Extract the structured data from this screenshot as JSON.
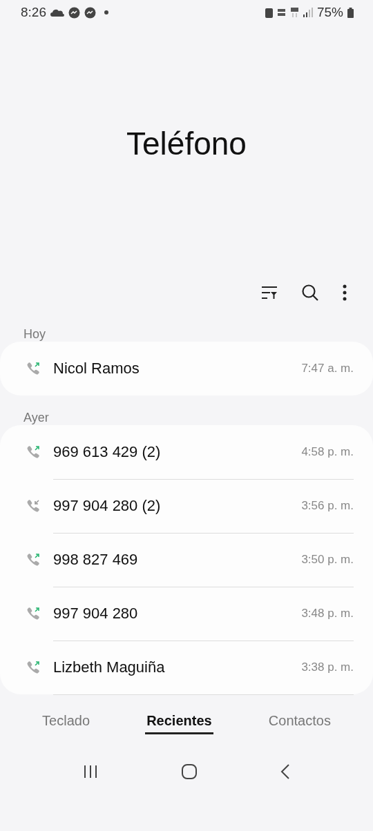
{
  "status_bar": {
    "time": "8:26",
    "battery": "75%"
  },
  "title": "Teléfono",
  "groups": [
    {
      "label": "Hoy",
      "calls": [
        {
          "name": "Nicol Ramos",
          "time": "7:47 a. m.",
          "kind": "outgoing"
        }
      ]
    },
    {
      "label": "Ayer",
      "calls": [
        {
          "name": "969 613 429 (2)",
          "time": "4:58 p. m.",
          "kind": "outgoing"
        },
        {
          "name": "997 904 280 (2)",
          "time": "3:56 p. m.",
          "kind": "incoming"
        },
        {
          "name": "998 827 469",
          "time": "3:50 p. m.",
          "kind": "outgoing"
        },
        {
          "name": "997 904 280",
          "time": "3:48 p. m.",
          "kind": "outgoing"
        },
        {
          "name": "Lizbeth Maguiña",
          "time": "3:38 p. m.",
          "kind": "outgoing"
        }
      ]
    }
  ],
  "tabs": [
    {
      "label": "Teclado",
      "selected": false
    },
    {
      "label": "Recientes",
      "selected": true
    },
    {
      "label": "Contactos",
      "selected": false
    }
  ]
}
